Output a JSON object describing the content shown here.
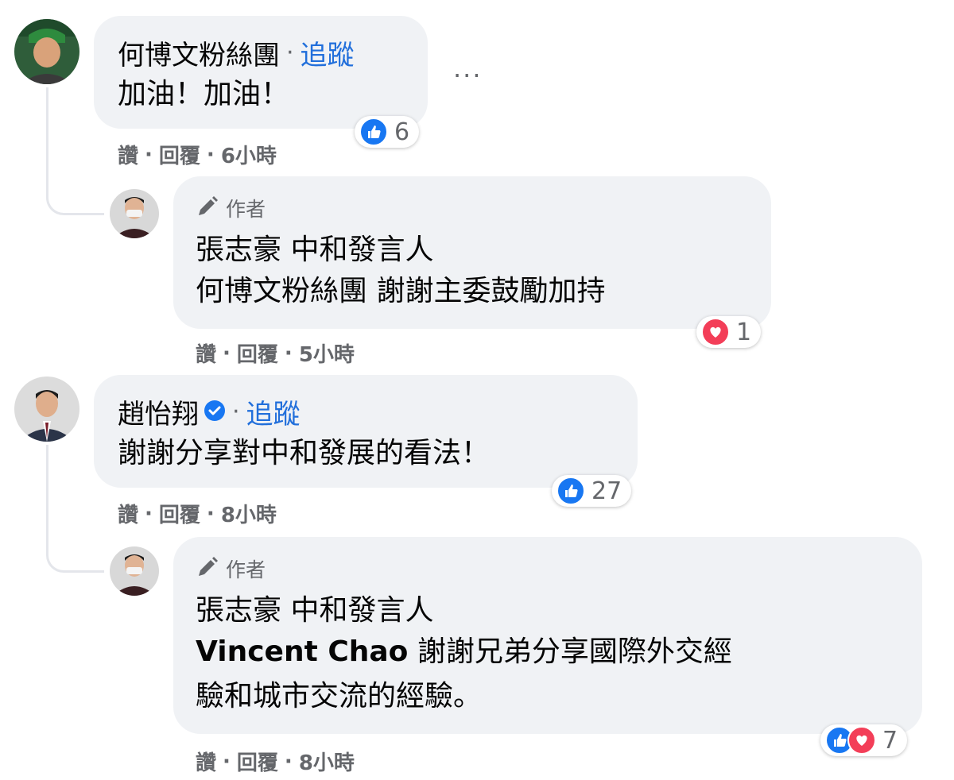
{
  "comments": [
    {
      "name": "何博文粉絲團",
      "follow_label": "追蹤",
      "text": "加油！加油！",
      "reaction_count": "6",
      "actions": {
        "like": "讚",
        "reply": "回覆",
        "time": "6小時"
      },
      "more_label": "···",
      "reply": {
        "author_badge": "作者",
        "line1": "張志豪 中和發言人",
        "line2_mention": "何博文粉絲團",
        "line2_text": " 謝謝主委鼓勵加持",
        "reaction_count": "1",
        "actions": {
          "like": "讚",
          "reply": "回覆",
          "time": "5小時"
        }
      }
    },
    {
      "name": "趙怡翔",
      "follow_label": "追蹤",
      "text": "謝謝分享對中和發展的看法！",
      "reaction_count": "27",
      "actions": {
        "like": "讚",
        "reply": "回覆",
        "time": "8小時"
      },
      "reply": {
        "author_badge": "作者",
        "line1": "張志豪 中和發言人",
        "line2_mention": "Vincent Chao",
        "line2_text": " 謝謝兄弟分享國際外交經",
        "line3": "驗和城市交流的經驗。",
        "reaction_count": "7",
        "actions": {
          "like": "讚",
          "reply": "回覆",
          "time": "8小時"
        }
      }
    }
  ],
  "colors": {
    "bubble": "#f0f2f5",
    "link": "#216fdb",
    "like": "#1877f2",
    "love": "#f33e58",
    "meta": "#65676b"
  }
}
